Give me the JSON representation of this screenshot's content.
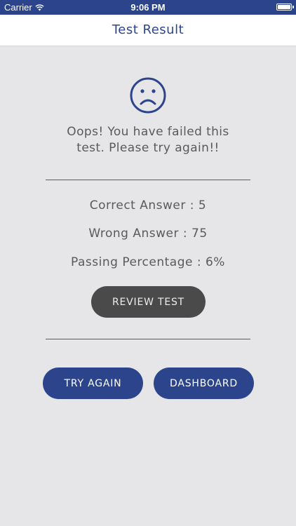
{
  "status_bar": {
    "carrier": "Carrier",
    "time": "9:06 PM",
    "icons": [
      "wifi-icon",
      "battery-icon"
    ]
  },
  "nav": {
    "title": "Test Result"
  },
  "result": {
    "icon": "sad-face-icon",
    "message_line1": "Oops! You have failed this",
    "message_line2": "test. Please try again!!"
  },
  "stats": {
    "correct": "Correct Answer : 5",
    "wrong": "Wrong Answer : 75",
    "passing": "Passing Percentage : 6%"
  },
  "buttons": {
    "review": "REVIEW TEST",
    "try_again": "TRY AGAIN",
    "dashboard": "DASHBOARD"
  },
  "colors": {
    "brand": "#2c448c",
    "background": "#e6e6e8",
    "review_button": "#4a4a4a"
  }
}
